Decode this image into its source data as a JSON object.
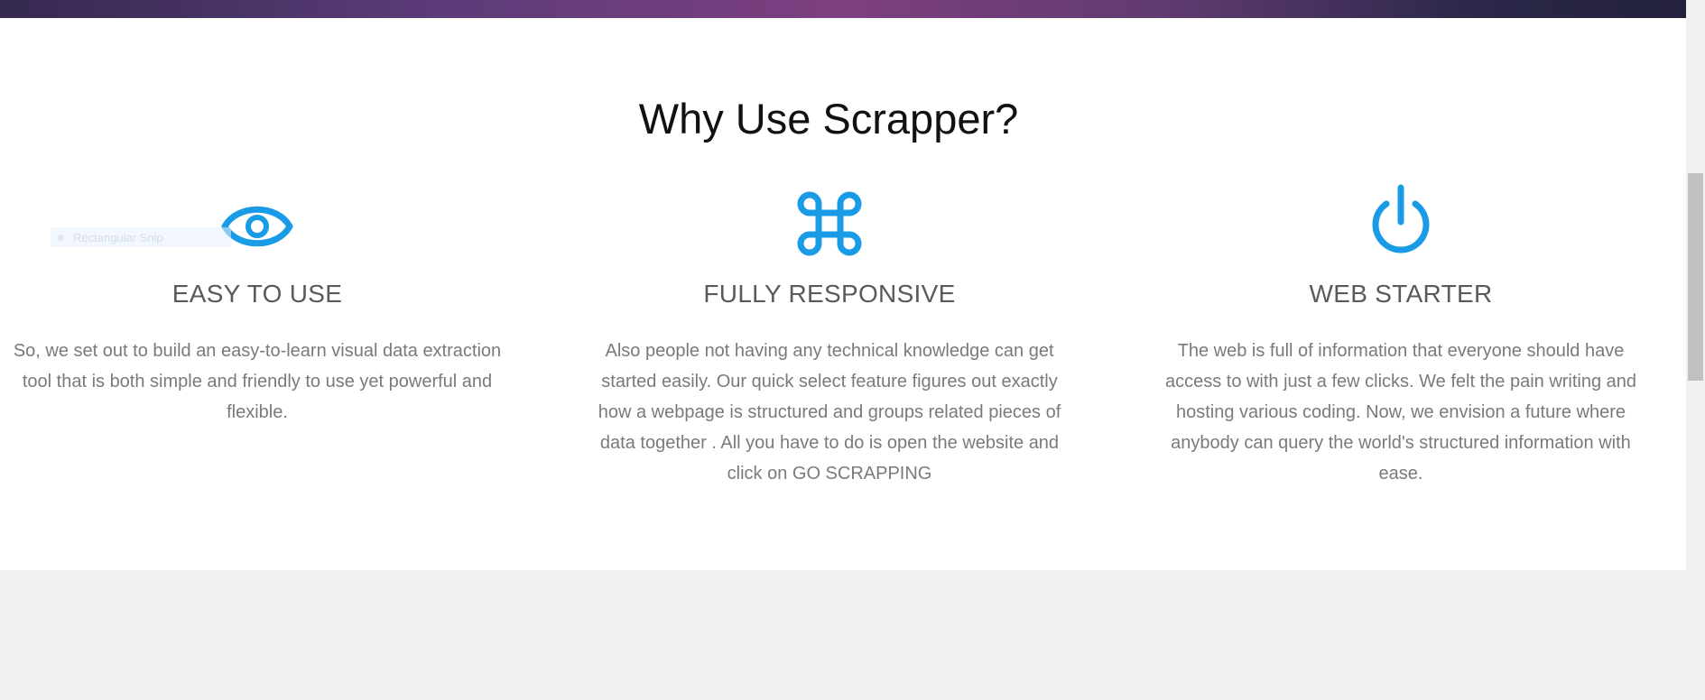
{
  "section": {
    "title": "Why Use Scrapper?"
  },
  "features": [
    {
      "icon": "eye-icon",
      "heading": "EASY TO USE",
      "description": "So, we set out to build an easy-to-learn visual data extraction tool that is both simple and friendly to use yet powerful and flexible."
    },
    {
      "icon": "command-icon",
      "heading": "FULLY RESPONSIVE",
      "description": "Also people not having any technical knowledge can get started easily. Our quick select feature figures out exactly how a webpage is structured and groups related pieces of data together . All you have to do is open the website and click on GO SCRAPPING"
    },
    {
      "icon": "power-icon",
      "heading": "WEB STARTER",
      "description": "The web is full of information that everyone should have access to with just a few clicks. We felt the pain writing and hosting various coding. Now, we envision a future where anybody can query the world's structured information with ease."
    }
  ],
  "overlay": {
    "label": "Rectangular Snip"
  },
  "colors": {
    "accent": "#1a9be6",
    "heading": "#5a5a5a",
    "body_text": "#7a7a7a",
    "title": "#111111"
  }
}
